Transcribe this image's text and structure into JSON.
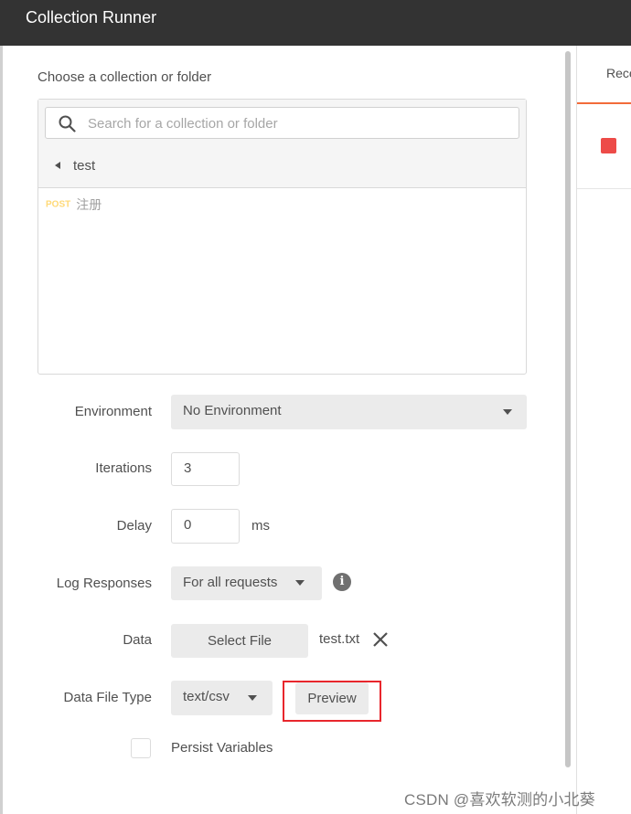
{
  "window": {
    "title": "Collection Runner"
  },
  "collection": {
    "label": "Choose a collection or folder",
    "search_placeholder": "Search for a collection or folder",
    "current_folder": "test",
    "requests": [
      {
        "method": "POST",
        "name": "注册"
      }
    ]
  },
  "form": {
    "environment": {
      "label": "Environment",
      "value": "No Environment"
    },
    "iterations": {
      "label": "Iterations",
      "value": "3"
    },
    "delay": {
      "label": "Delay",
      "value": "0",
      "unit": "ms"
    },
    "log_responses": {
      "label": "Log Responses",
      "value": "For all requests"
    },
    "data": {
      "label": "Data",
      "button": "Select File",
      "file_name": "test.txt"
    },
    "data_file_type": {
      "label": "Data File Type",
      "value": "text/csv",
      "preview_button": "Preview"
    },
    "persist_variables": {
      "label": "Persist Variables",
      "checked": false
    }
  },
  "right_pane": {
    "tab_label": "Rece",
    "accent_color": "#f26b3a",
    "status_color": "#ed4b48"
  },
  "watermark": "CSDN @喜欢软测的小北葵",
  "icons": [
    "search-icon",
    "back-arrow-icon",
    "chevron-down-icon",
    "info-icon",
    "close-icon"
  ]
}
